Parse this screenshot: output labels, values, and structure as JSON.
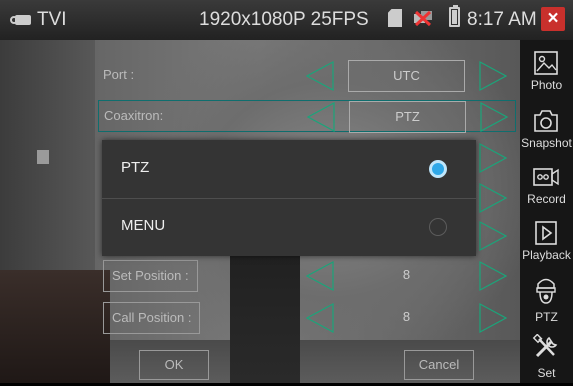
{
  "status_bar": {
    "mode": "TVI",
    "mode_icon": "camera-icon",
    "resolution": "1920x1080P 25FPS",
    "time": "8:17 AM",
    "close_label": "×"
  },
  "menu": {
    "rows": [
      {
        "label": "Port :",
        "value": "UTC"
      },
      {
        "label": "Coaxitron:",
        "value": "PTZ"
      },
      {
        "label": "Set Position :",
        "value": "8"
      },
      {
        "label": "Call Position :",
        "value": "8"
      }
    ],
    "ok_label": "OK",
    "cancel_label": "Cancel"
  },
  "dialog": {
    "options": [
      {
        "label": "PTZ",
        "selected": true
      },
      {
        "label": "MENU",
        "selected": false
      }
    ]
  },
  "sidebar": {
    "items": [
      {
        "label": "Photo",
        "icon": "photo-icon"
      },
      {
        "label": "Snapshot",
        "icon": "snapshot-icon"
      },
      {
        "label": "Record",
        "icon": "record-icon"
      },
      {
        "label": "Playback",
        "icon": "playback-icon"
      },
      {
        "label": "PTZ",
        "icon": "ptz-camera-icon"
      },
      {
        "label": "Set",
        "icon": "settings-tools-icon"
      }
    ]
  },
  "colors": {
    "highlight": "#0f6e6e",
    "radio_selected": "#2fa8e8",
    "close": "#c9302c",
    "arrow_stroke": "#1aa57a"
  }
}
